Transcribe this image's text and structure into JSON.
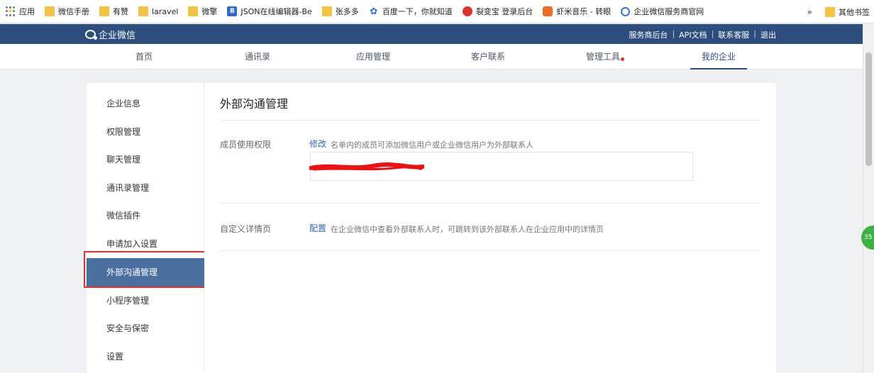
{
  "bookmarks": {
    "items": [
      {
        "label": "应用",
        "icon": "apps-grid-icon"
      },
      {
        "label": "微信手册",
        "icon": "folder-icon"
      },
      {
        "label": "有赞",
        "icon": "folder-icon"
      },
      {
        "label": "laravel",
        "icon": "folder-icon"
      },
      {
        "label": "微擎",
        "icon": "folder-icon"
      },
      {
        "label": "JSON在线编辑器-Be",
        "icon": "json-editor-icon"
      },
      {
        "label": "张多多",
        "icon": "folder-icon"
      },
      {
        "label": "百度一下，你就知道",
        "icon": "baidu-paw-icon"
      },
      {
        "label": "裂变宝 登录后台",
        "icon": "liebianbao-icon"
      },
      {
        "label": "虾米音乐 - 转眼",
        "icon": "xiami-icon"
      },
      {
        "label": "企业微信服务商官网",
        "icon": "wework-icon"
      }
    ],
    "more": "»",
    "other": "其他书签"
  },
  "topbar": {
    "brand": "企业微信",
    "links": [
      "服务商后台",
      "API文档",
      "联系客服",
      "退出"
    ],
    "separator": "|"
  },
  "nav": {
    "tabs": [
      "首页",
      "通讯录",
      "应用管理",
      "客户联系",
      "管理工具",
      "我的企业"
    ],
    "active_index": 5,
    "notify_tab_index": 4
  },
  "sidebar": {
    "items": [
      "企业信息",
      "权限管理",
      "聊天管理",
      "通讯录管理",
      "微信插件",
      "申请加入设置",
      "外部沟通管理",
      "小程序管理",
      "安全与保密",
      "设置"
    ],
    "active_index": 6
  },
  "main": {
    "title": "外部沟通管理",
    "rows": [
      {
        "label": "成员使用权限",
        "link": "修改",
        "desc": "名单内的成员可添加微信用户或企业微信用户为外部联系人"
      },
      {
        "label": "自定义详情页",
        "link": "配置",
        "desc": "在企业微信中查看外部联系人时，可跳转到该外部联系人在企业应用中的详情页"
      }
    ]
  },
  "badge": {
    "text": "35"
  },
  "colors": {
    "topbar": "#2c4d7e",
    "active_sidebar": "#4b6ea0",
    "link": "#2c6ab8",
    "highlight": "#e0312b"
  }
}
